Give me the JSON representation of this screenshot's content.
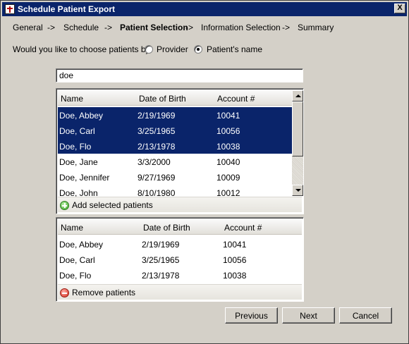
{
  "window": {
    "title": "Schedule Patient Export",
    "close_glyph": "X"
  },
  "steps": {
    "general": "General",
    "arrow1": "->",
    "schedule": "Schedule",
    "arrow2": "->",
    "patient_selection": "Patient Selection",
    "arrow3": "->",
    "information_selection": "Information Selection",
    "arrow4": "->",
    "summary": "Summary"
  },
  "choose": {
    "question": "Would you like to choose patients by:",
    "option_provider": "Provider",
    "option_name": "Patient's name",
    "selected": "Patient's name"
  },
  "search": {
    "value": "doe"
  },
  "results": {
    "columns": [
      "Name",
      "Date of Birth",
      "Account #"
    ],
    "rows": [
      {
        "name": "Doe, Abbey",
        "dob": "2/19/1969",
        "account": "10041",
        "selected": true
      },
      {
        "name": "Doe, Carl",
        "dob": "3/25/1965",
        "account": "10056",
        "selected": true
      },
      {
        "name": "Doe, Flo",
        "dob": "2/13/1978",
        "account": "10038",
        "selected": true
      },
      {
        "name": "Doe, Jane",
        "dob": "3/3/2000",
        "account": "10040",
        "selected": false
      },
      {
        "name": "Doe, Jennifer",
        "dob": "9/27/1969",
        "account": "10009",
        "selected": false
      },
      {
        "name": "Doe, John",
        "dob": "8/10/1980",
        "account": "10012",
        "selected": false
      }
    ],
    "add_label": "Add selected patients"
  },
  "selected_patients": {
    "columns": [
      "Name",
      "Date of Birth",
      "Account #"
    ],
    "rows": [
      {
        "name": "Doe, Abbey",
        "dob": "2/19/1969",
        "account": "10041"
      },
      {
        "name": "Doe, Carl",
        "dob": "3/25/1965",
        "account": "10056"
      },
      {
        "name": "Doe, Flo",
        "dob": "2/13/1978",
        "account": "10038"
      }
    ],
    "remove_label": "Remove patients"
  },
  "buttons": {
    "previous": "Previous",
    "next": "Next",
    "cancel": "Cancel"
  },
  "colors": {
    "selection": "#0a246a",
    "dialog_bg": "#d4d0c8",
    "add_icon": "#3ea82a",
    "remove_icon": "#d42a1c"
  }
}
